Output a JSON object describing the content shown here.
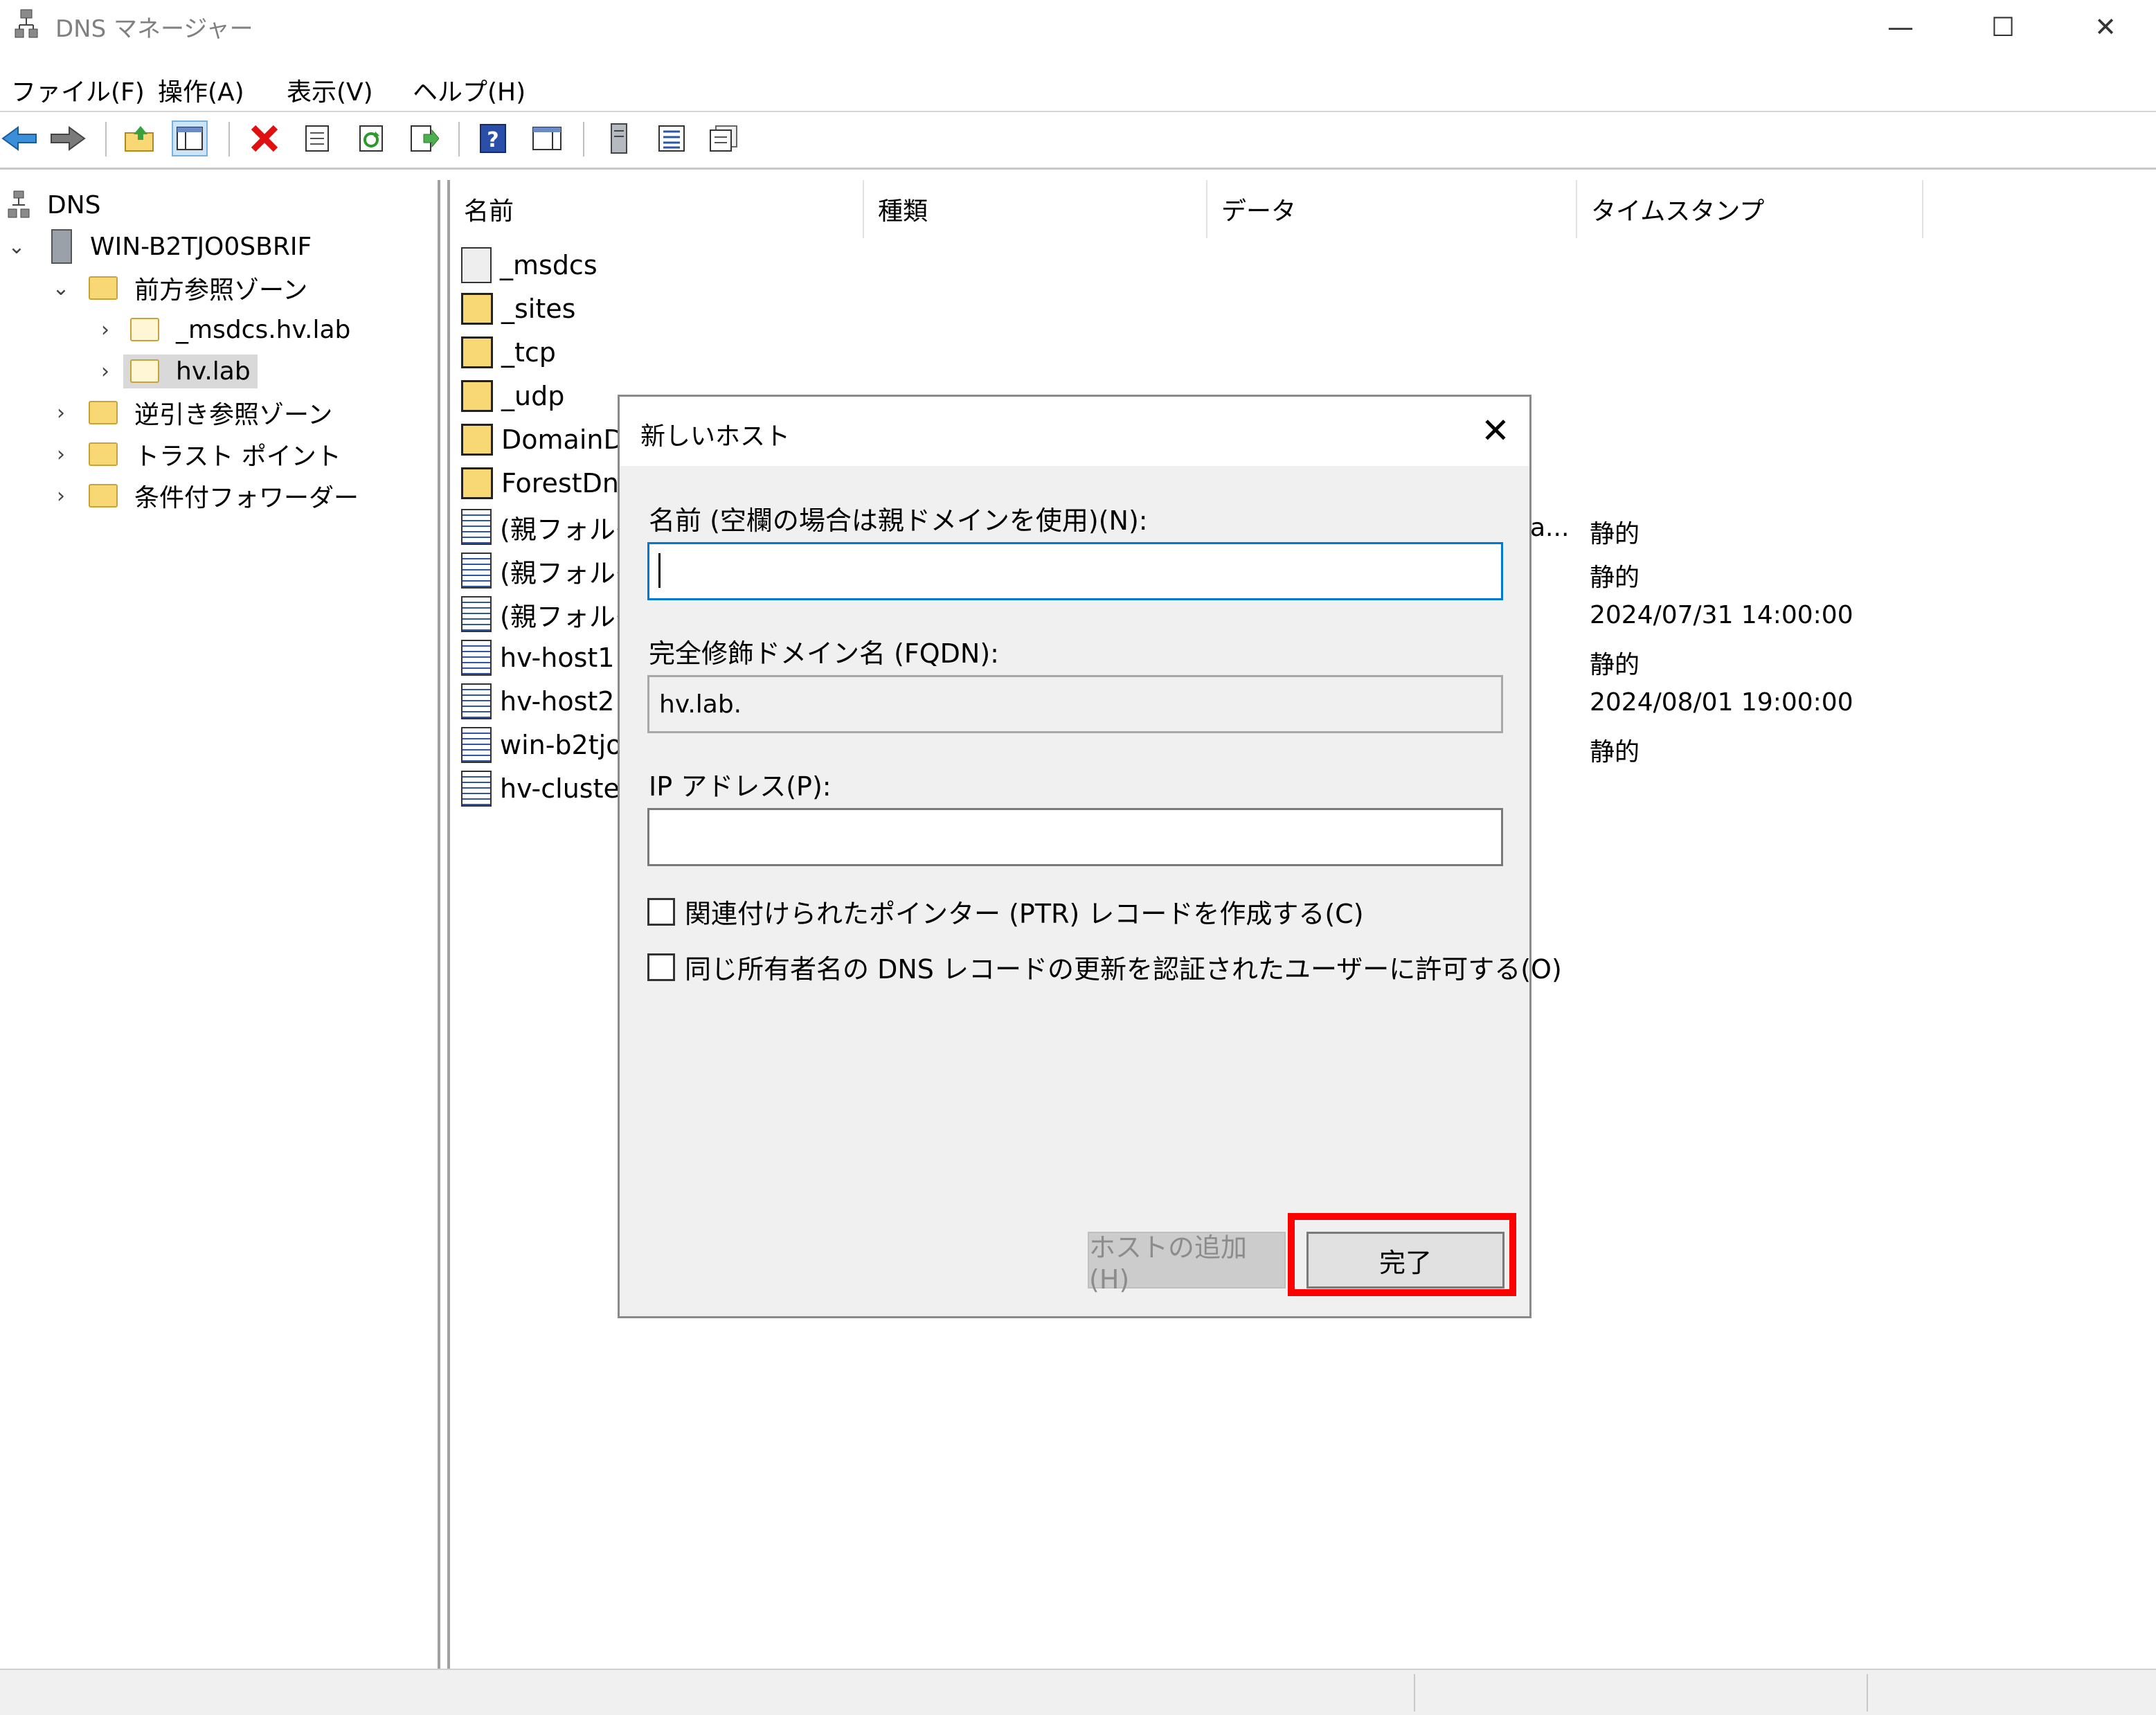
{
  "window": {
    "title": "DNS マネージャー",
    "title_icon": "dns-manager-icon",
    "minimize_label": "—",
    "maximize_label": "☐",
    "close_label": "✕"
  },
  "menu": [
    "ファイル(F)",
    "操作(A)",
    "表示(V)",
    "ヘルプ(H)"
  ],
  "toolbar_icons": [
    "back-arrow-icon",
    "forward-arrow-icon",
    "up-folder-icon",
    "show-hide-console-tree-icon",
    "delete-icon",
    "properties-icon",
    "refresh-icon",
    "export-list-icon",
    "help-icon",
    "action-pane-icon",
    "server-icon",
    "list-view-icon",
    "details-view-icon"
  ],
  "tree": {
    "root": "DNS",
    "server": "WIN-B2TJO0SBRIF",
    "forward_zones": "前方参照ゾーン",
    "zone_msdcs": "_msdcs.hv.lab",
    "zone_hvlab": "hv.lab",
    "reverse_zones": "逆引き参照ゾーン",
    "trust_points": "トラスト ポイント",
    "conditional_forwarders": "条件付フォワーダー"
  },
  "list": {
    "columns": [
      "名前",
      "種類",
      "データ",
      "タイムスタンプ"
    ],
    "rows": [
      {
        "name": "_msdcs",
        "icon": "zone-delegation-icon",
        "ts": ""
      },
      {
        "name": "_sites",
        "icon": "folder-icon",
        "ts": ""
      },
      {
        "name": "_tcp",
        "icon": "folder-icon",
        "ts": ""
      },
      {
        "name": "_udp",
        "icon": "folder-icon",
        "ts": ""
      },
      {
        "name": "DomainDr",
        "icon": "folder-icon",
        "ts": ""
      },
      {
        "name": "ForestDns",
        "icon": "folder-icon",
        "ts": ""
      },
      {
        "name": "(親フォルダ",
        "icon": "record-icon",
        "data_tail": "a...",
        "ts": "静的"
      },
      {
        "name": "(親フォルダ",
        "icon": "record-icon",
        "ts": "静的"
      },
      {
        "name": "(親フォルダ",
        "icon": "record-icon",
        "ts": "2024/07/31 14:00:00"
      },
      {
        "name": "hv-host1",
        "icon": "record-icon",
        "ts": "静的"
      },
      {
        "name": "hv-host2",
        "icon": "record-icon",
        "ts": "2024/08/01 19:00:00"
      },
      {
        "name": "win-b2tjo",
        "icon": "record-icon",
        "ts": "静的"
      },
      {
        "name": "hv-cluster",
        "icon": "record-icon",
        "ts": ""
      }
    ]
  },
  "dialog": {
    "title": "新しいホスト",
    "close_label": "✕",
    "name_label": "名前 (空欄の場合は親ドメインを使用)(N):",
    "name_value": "",
    "fqdn_label": "完全修飾ドメイン名 (FQDN):",
    "fqdn_value": "hv.lab.",
    "ip_label": "IP アドレス(P):",
    "ip_value": "",
    "ptr_checkbox": "関連付けられたポインター (PTR) レコードを作成する(C)",
    "auth_checkbox": "同じ所有者名の DNS レコードの更新を認証されたユーザーに許可する(O)",
    "add_host_button": "ホストの追加(H)",
    "finish_button": "完了"
  },
  "colors": {
    "highlight": "#ff0000",
    "focus_border": "#0078d7",
    "folder": "#f8d775"
  }
}
